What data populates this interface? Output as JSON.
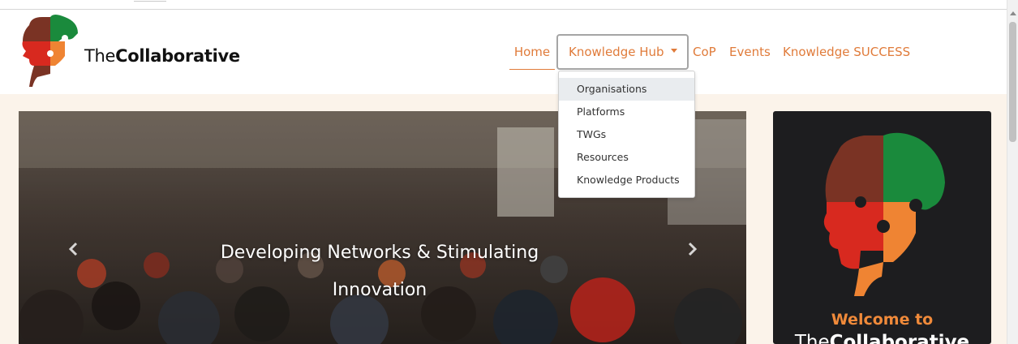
{
  "brand": {
    "name_regular": "The",
    "name_bold": "Collaborative",
    "logo_icon": "puzzle-head-icon",
    "colors": {
      "maroon": "#7a3324",
      "green": "#1a8a3c",
      "red": "#d8291f",
      "orange": "#ef8433"
    }
  },
  "nav": {
    "items": [
      {
        "label": "Home"
      },
      {
        "label": "Knowledge Hub"
      },
      {
        "label": "CoP"
      },
      {
        "label": "Events"
      },
      {
        "label": "Knowledge SUCCESS"
      }
    ],
    "accent_color": "#e07b3a"
  },
  "dropdown": {
    "items": [
      {
        "label": "Organisations",
        "highlighted": true
      },
      {
        "label": "Platforms"
      },
      {
        "label": "TWGs"
      },
      {
        "label": "Resources"
      },
      {
        "label": "Knowledge Products"
      }
    ]
  },
  "carousel": {
    "caption": "Developing Networks & Stimulating Innovation",
    "prev_icon": "chevron-left-icon",
    "next_icon": "chevron-right-icon"
  },
  "side_card": {
    "welcome": "Welcome to",
    "name_regular": "The",
    "name_bold": "Collaborative"
  }
}
